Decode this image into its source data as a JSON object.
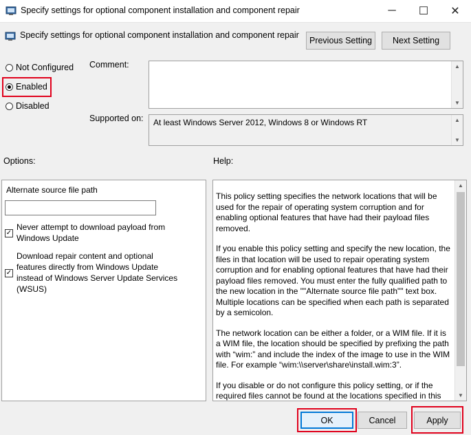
{
  "window": {
    "title": "Specify settings for optional component installation and component repair",
    "minimize": "─",
    "maximize": "☐",
    "close": "✕"
  },
  "header": {
    "title": "Specify settings for optional component installation and component repair",
    "previous_label": "Previous Setting",
    "next_label": "Next Setting"
  },
  "state": {
    "not_configured_label": "Not Configured",
    "enabled_label": "Enabled",
    "disabled_label": "Disabled",
    "selected": "Enabled"
  },
  "comment": {
    "label": "Comment:",
    "value": ""
  },
  "supported": {
    "label": "Supported on:",
    "value": "At least Windows Server 2012, Windows 8 or Windows RT"
  },
  "options": {
    "label": "Options:",
    "alt_source_label": "Alternate source file path",
    "alt_source_value": "",
    "never_download_label": "Never attempt to download payload from Windows Update",
    "never_download_checked": true,
    "download_repair_label": "Download repair content and optional features directly from Windows Update instead of Windows Server Update Services (WSUS)",
    "download_repair_checked": true
  },
  "help": {
    "label": "Help:",
    "paragraphs": [
      "This policy setting specifies the network locations that will be used for the repair of operating system corruption and for enabling optional features that have had their payload files removed.",
      "If you enable this policy setting and specify the new location, the files in that location will be used to repair operating system corruption and for enabling optional features that have had their payload files removed. You must enter the fully qualified path to the new location in the \"\"Alternate source file path\"\" text box. Multiple locations can be specified when each path is separated by a semicolon.",
      "The network location can be either a folder, or a WIM file. If it is a WIM file, the location should be specified by prefixing the path with “wim:” and include the index of the image to use in the WIM file. For example “wim:\\\\server\\share\\install.wim:3”.",
      "If you disable or do not configure this policy setting, or if the required files cannot be found at the locations specified in this policy setting, the files will be downloaded from Windows Update"
    ]
  },
  "footer": {
    "ok_label": "OK",
    "cancel_label": "Cancel",
    "apply_label": "Apply"
  },
  "colors": {
    "highlight": "#e0001b",
    "ok_border": "#0078d7"
  }
}
